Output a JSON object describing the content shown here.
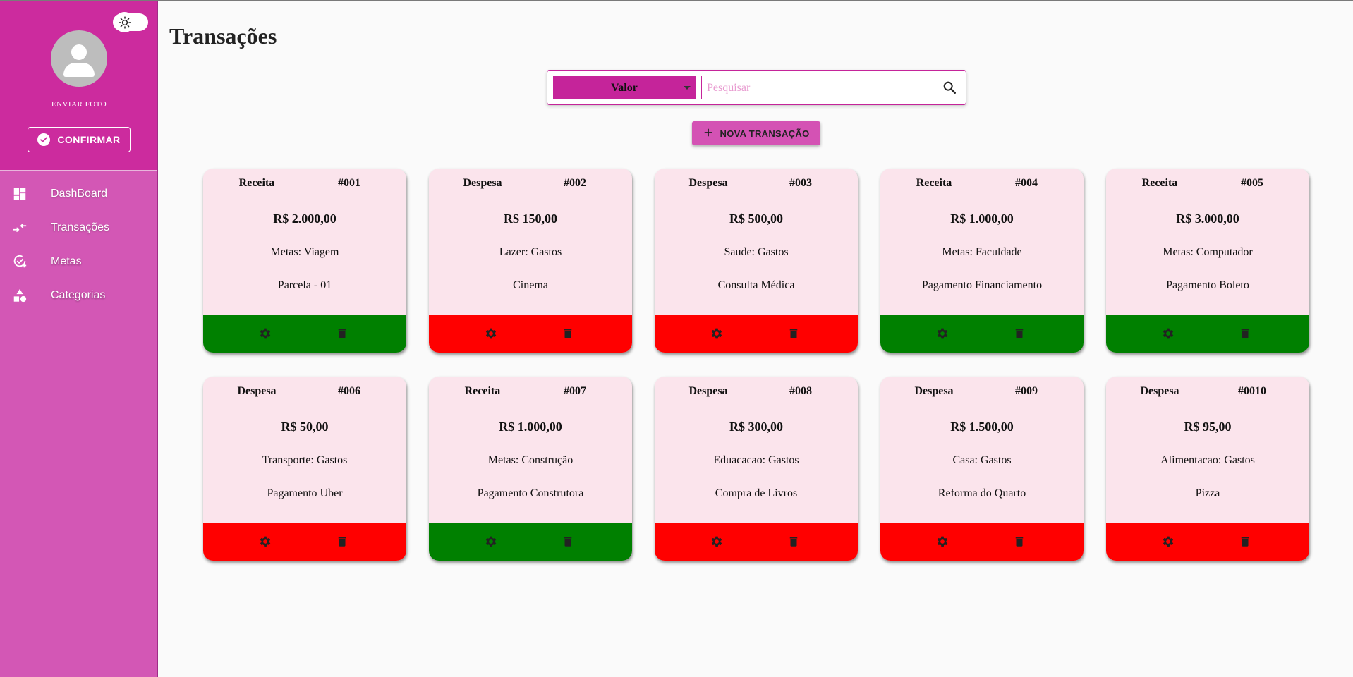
{
  "sidebar": {
    "upload_label": "ENVIAR FOTO",
    "confirm_label": "CONFIRMAR",
    "items": [
      {
        "label": "DashBoard",
        "icon": "dashboard-icon"
      },
      {
        "label": "Transações",
        "icon": "transactions-icon"
      },
      {
        "label": "Metas",
        "icon": "goals-icon"
      },
      {
        "label": "Categorias",
        "icon": "categories-icon"
      }
    ]
  },
  "page": {
    "title": "Transações"
  },
  "search": {
    "filter_value": "Valor",
    "placeholder": "Pesquisar"
  },
  "new_transaction_label": "NOVA TRANSAÇÃO",
  "colors": {
    "primary": "#cc2b9e",
    "sidebar": "#d357b5",
    "receita": "#008000",
    "despesa": "#ff0000",
    "card_bg": "#fbe4ec"
  },
  "transactions": [
    {
      "type": "Receita",
      "id": "#001",
      "value": "R$ 2.000,00",
      "category": "Metas: Viagem",
      "description": "Parcela - 01"
    },
    {
      "type": "Despesa",
      "id": "#002",
      "value": "R$ 150,00",
      "category": "Lazer: Gastos",
      "description": "Cinema"
    },
    {
      "type": "Despesa",
      "id": "#003",
      "value": "R$ 500,00",
      "category": "Saude: Gastos",
      "description": "Consulta Médica"
    },
    {
      "type": "Receita",
      "id": "#004",
      "value": "R$ 1.000,00",
      "category": "Metas: Faculdade",
      "description": "Pagamento Financiamento"
    },
    {
      "type": "Receita",
      "id": "#005",
      "value": "R$ 3.000,00",
      "category": "Metas: Computador",
      "description": "Pagamento Boleto"
    },
    {
      "type": "Despesa",
      "id": "#006",
      "value": "R$ 50,00",
      "category": "Transporte: Gastos",
      "description": "Pagamento Uber"
    },
    {
      "type": "Receita",
      "id": "#007",
      "value": "R$ 1.000,00",
      "category": "Metas: Construção",
      "description": "Pagamento Construtora"
    },
    {
      "type": "Despesa",
      "id": "#008",
      "value": "R$ 300,00",
      "category": "Eduacacao: Gastos",
      "description": "Compra de Livros"
    },
    {
      "type": "Despesa",
      "id": "#009",
      "value": "R$ 1.500,00",
      "category": "Casa: Gastos",
      "description": "Reforma do Quarto"
    },
    {
      "type": "Despesa",
      "id": "#0010",
      "value": "R$ 95,00",
      "category": "Alimentacao: Gastos",
      "description": "Pizza"
    }
  ]
}
